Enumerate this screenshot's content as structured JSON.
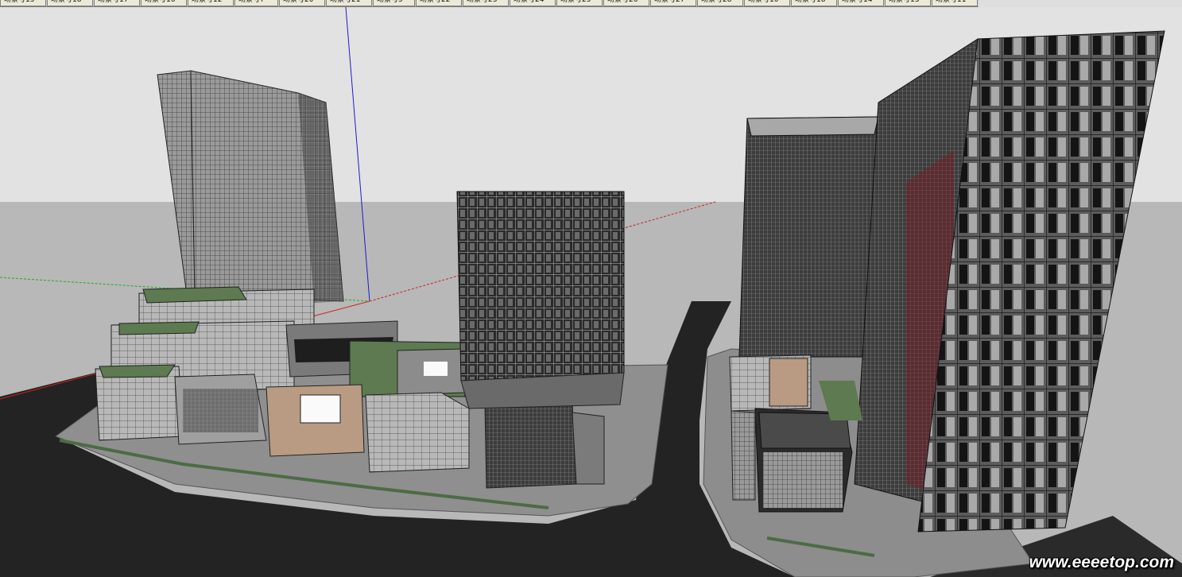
{
  "scene_tabs": [
    "场景号15",
    "场景号18",
    "场景号17",
    "场景号16",
    "场景号12",
    "场景号7",
    "场景号20",
    "场景号21",
    "场景号5",
    "场景号22",
    "场景号23",
    "场景号24",
    "场景号25",
    "场景号26",
    "场景号27",
    "场景号28",
    "场景号10",
    "场景号18",
    "场景号14",
    "场景号13",
    "场景号11"
  ],
  "watermark": "www.eeeetop.com",
  "colors": {
    "sky": "#e2e2e2",
    "ground": "#b5b5b5",
    "road": "#232323",
    "sidewalk": "#8f8f8f",
    "glass": "#8a8a8a",
    "dark_glass": "#2b2b2b",
    "green_roof": "#5d7a50",
    "blue_axis": "#1d1dcc",
    "red_axis": "#cc2222",
    "green_axis": "#22aa22"
  }
}
